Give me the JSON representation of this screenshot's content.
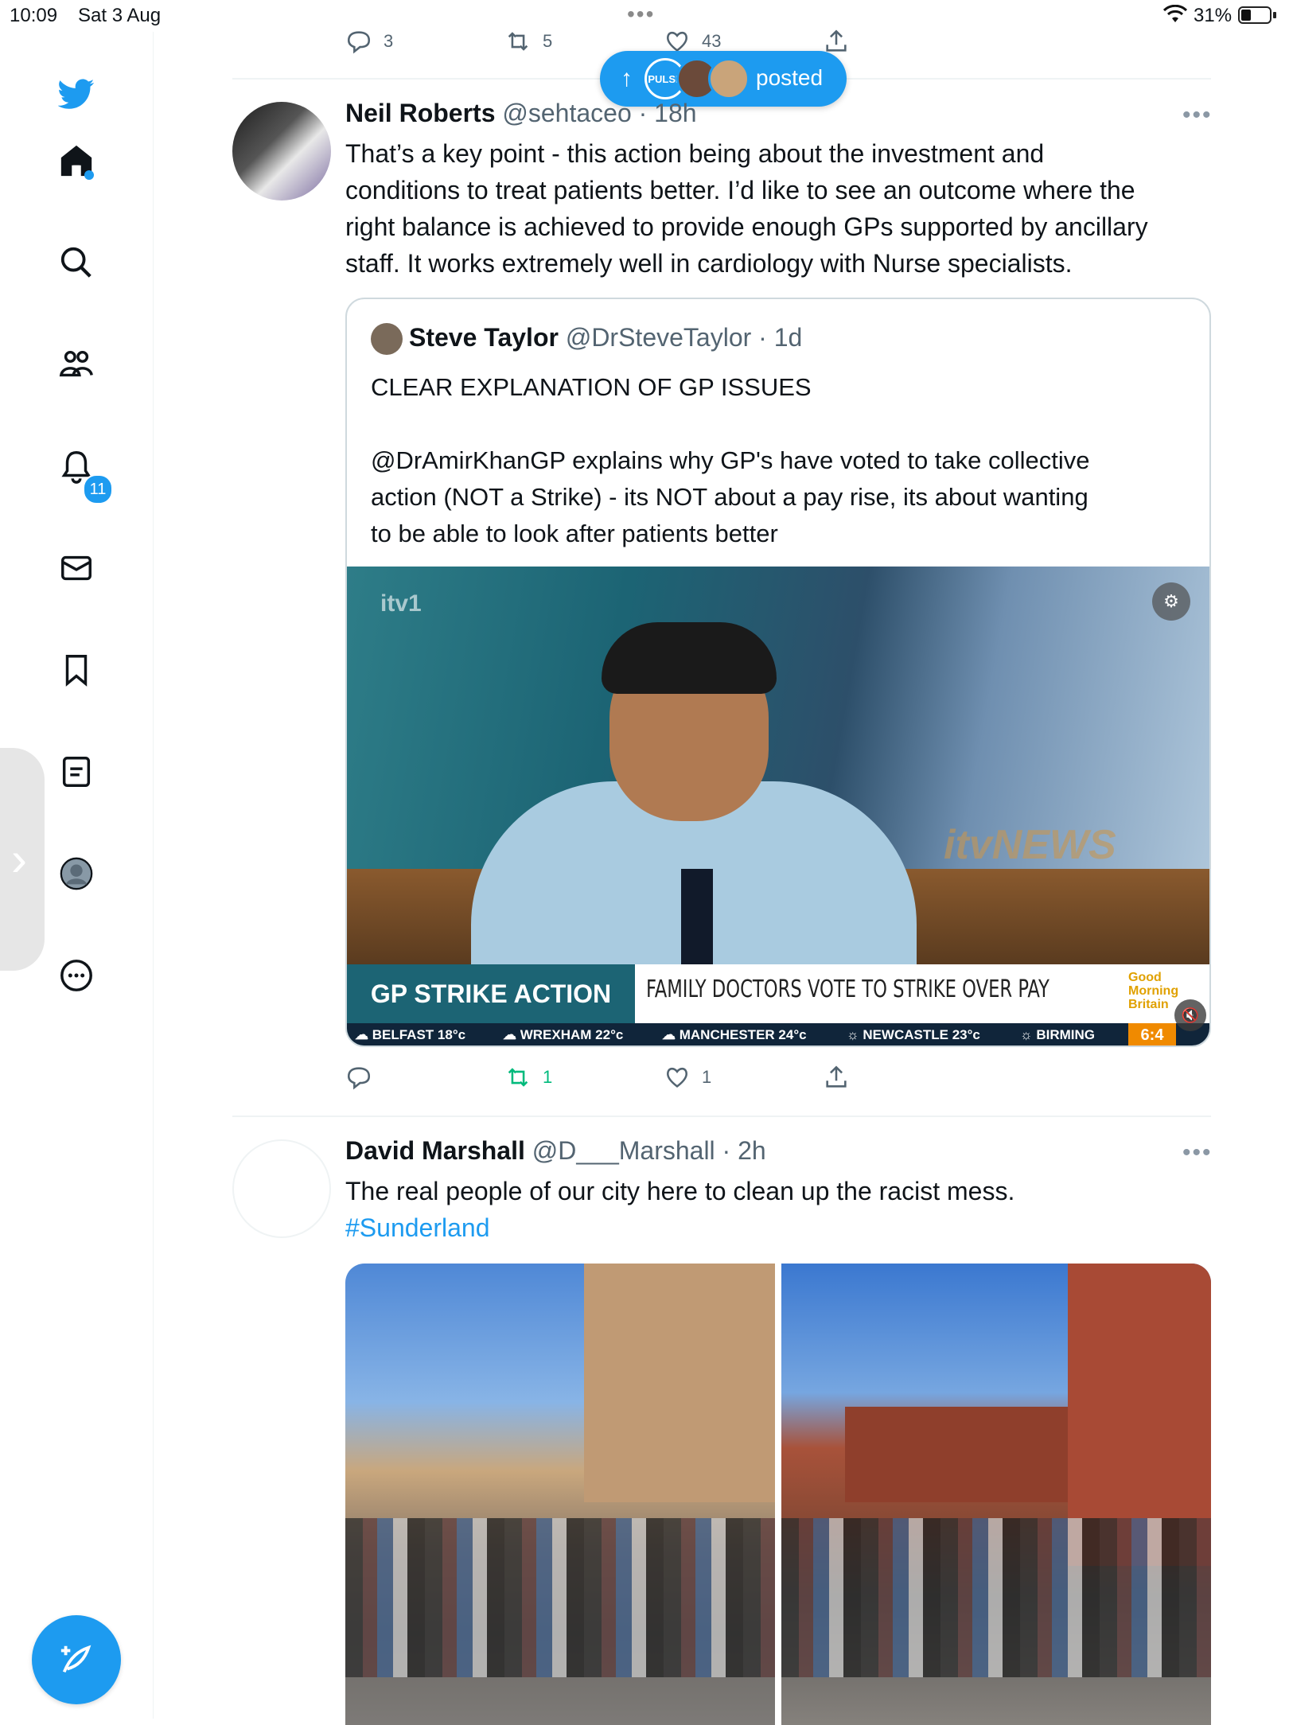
{
  "status_bar": {
    "time": "10:09",
    "date": "Sat 3 Aug",
    "battery": "31%",
    "multitask_dots": "•••"
  },
  "sidebar": {
    "items": [
      {
        "name": "twitter-logo-icon"
      },
      {
        "name": "home-icon"
      },
      {
        "name": "search-icon"
      },
      {
        "name": "communities-icon"
      },
      {
        "name": "notifications-icon",
        "badge": "11"
      },
      {
        "name": "messages-icon"
      },
      {
        "name": "bookmarks-icon"
      },
      {
        "name": "lists-icon"
      },
      {
        "name": "profile-icon"
      },
      {
        "name": "more-icon"
      }
    ],
    "handle_chevron": "›"
  },
  "top_actions": {
    "replies": "3",
    "retweets": "5",
    "likes": "43"
  },
  "new_posts_pill": {
    "arrow": "↑",
    "avatar_text": "PULSE",
    "label": "posted"
  },
  "tweets": [
    {
      "name": "Neil Roberts",
      "handle": "@sehtaceo",
      "time": "· 18h",
      "more": "•••",
      "text_lines": [
        "That’s a key point - this action being about the investment and",
        "conditions to treat patients better. I’d like to see an outcome where the",
        "right balance is achieved to provide enough GPs supported by ancillary",
        "staff. It works extremely well in cardiology with Nurse specialists."
      ],
      "quote": {
        "name": "Steve Taylor",
        "handle": "@DrSteveTaylor",
        "time": "· 1d",
        "line1": "CLEAR EXPLANATION OF GP ISSUES",
        "body_lines": [
          "@DrAmirKhanGP explains why GP's have voted to take collective",
          "action (NOT a Strike) - its NOT about a pay rise, its about wanting",
          "to be able to look after patients better"
        ],
        "video": {
          "channel": "itv1",
          "studio_logo": "itvNEWS",
          "banner_left": "GP STRIKE ACTION",
          "banner_right": "FAMILY DOCTORS VOTE TO STRIKE OVER PAY",
          "show": [
            "Good",
            "Morning",
            "Britain"
          ],
          "weather": [
            "BELFAST 18°c",
            "WREXHAM 22°c",
            "MANCHESTER 24°c",
            "NEWCASTLE 23°c",
            "BIRMING"
          ],
          "clock": "6:4"
        }
      },
      "actions": {
        "replies": "",
        "retweets": "1",
        "likes": "1"
      }
    },
    {
      "name": "David Marshall",
      "handle": "@D___Marshall",
      "time": "· 2h",
      "more": "•••",
      "text_lines": [
        "The real people of our city here to clean up the racist mess."
      ],
      "hashtag": "#Sunderland"
    }
  ],
  "colors": {
    "accent": "#1d9bf0",
    "retweet_green": "#00ba7c",
    "secondary_text": "#536471"
  }
}
